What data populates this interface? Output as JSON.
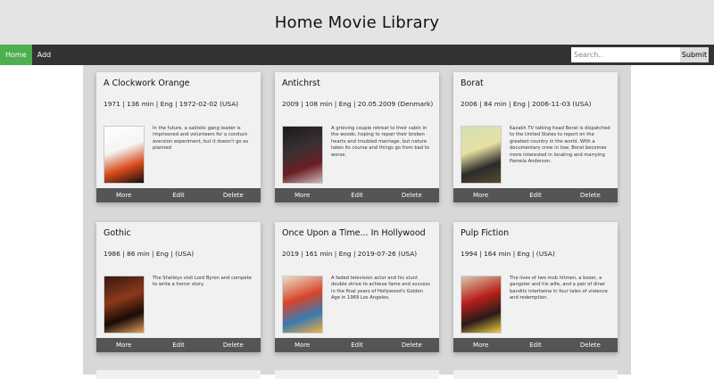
{
  "header": {
    "title": "Home Movie Library"
  },
  "nav": {
    "items": [
      {
        "label": "Home",
        "active": true
      },
      {
        "label": "Add",
        "active": false
      }
    ],
    "search": {
      "placeholder": "Search..",
      "value": "",
      "button_label": "Submit"
    }
  },
  "actions": {
    "more": "More",
    "edit": "Edit",
    "delete": "Delete"
  },
  "movies": [
    {
      "title": "A Clockwork Orange",
      "meta": "1971 | 136 min | Eng | 1972-02-02 (USA)",
      "description": "In the future, a sadistic gang leader is imprisoned and volunteers for a conduct-aversion experiment, but it doesn't go as planned",
      "poster_colors": [
        "#ffffff",
        "#f5f5f5",
        "#111111",
        "#d84a1b"
      ]
    },
    {
      "title": "Antichrst",
      "meta": "2009 | 108 min | Eng | 20.05.2009 (Denmark)",
      "description": "A grieving couple retreat to their cabin in the woods, hoping to repair their broken hearts and troubled marriage, but nature takes its course and things go from bad to worse.",
      "poster_colors": [
        "#1a1a1a",
        "#3a3033",
        "#c9b8b8",
        "#6b1f24"
      ]
    },
    {
      "title": "Borat",
      "meta": "2006 | 84 min | Eng | 2006-11-03 (USA)",
      "description": "Kazakh TV talking head Borat is dispatched to the United States to report on the greatest country in the world. With a documentary crew in tow, Borat becomes more interested in locating and marrying Pamela Anderson.",
      "poster_colors": [
        "#cfe2b8",
        "#e8e0a0",
        "#5a4a2a",
        "#2b2b2b"
      ]
    },
    {
      "title": "Gothic",
      "meta": "1986 | 86 min | Eng | (USA)",
      "description": "The Shelleys visit Lord Byron and compete to write a horror story.",
      "poster_colors": [
        "#3a1810",
        "#8a3a1a",
        "#e0a060",
        "#1a0a05"
      ]
    },
    {
      "title": "Once Upon a Time... In Hollywood",
      "meta": "2019 | 161 min | Eng | 2019-07-26 (USA)",
      "description": "A faded television actor and his stunt double strive to achieve fame and success in the final years of Hollywood's Golden Age in 1969 Los Angeles.",
      "poster_colors": [
        "#e8e0c8",
        "#d8442a",
        "#f0b040",
        "#3a7ab0"
      ]
    },
    {
      "title": "Pulp Fiction",
      "meta": "1994 | 164 min | Eng | (USA)",
      "description": "The lives of two mob hitmen, a boxer, a gangster and his wife, and a pair of diner bandits intertwine in four tales of violence and redemption.",
      "poster_colors": [
        "#d8c8a8",
        "#b8201a",
        "#f0d040",
        "#2a1a1a"
      ]
    }
  ]
}
